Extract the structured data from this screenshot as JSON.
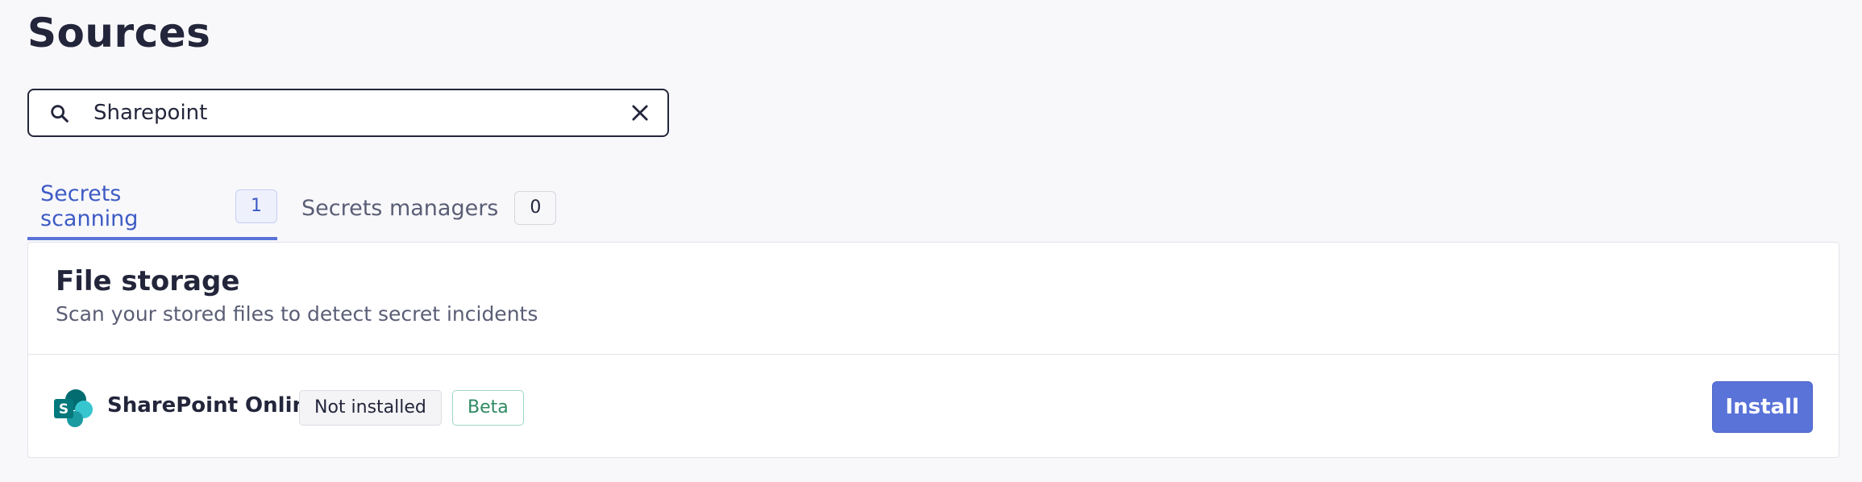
{
  "page": {
    "title": "Sources"
  },
  "search": {
    "value": "Sharepoint",
    "placeholder": ""
  },
  "tabs": [
    {
      "label": "Secrets scanning",
      "count": "1",
      "active": true
    },
    {
      "label": "Secrets managers",
      "count": "0",
      "active": false
    }
  ],
  "section": {
    "title": "File storage",
    "subtitle": "Scan your stored files to detect secret incidents"
  },
  "sources": [
    {
      "name": "SharePoint Online",
      "icon": "sharepoint-icon",
      "status": "Not installed",
      "tag": "Beta",
      "action": "Install"
    }
  ],
  "colors": {
    "accent": "#5a73d9",
    "text": "#23263b",
    "muted": "#5a5e75",
    "beta": "#2e8a62",
    "background": "#f8f8fb"
  }
}
